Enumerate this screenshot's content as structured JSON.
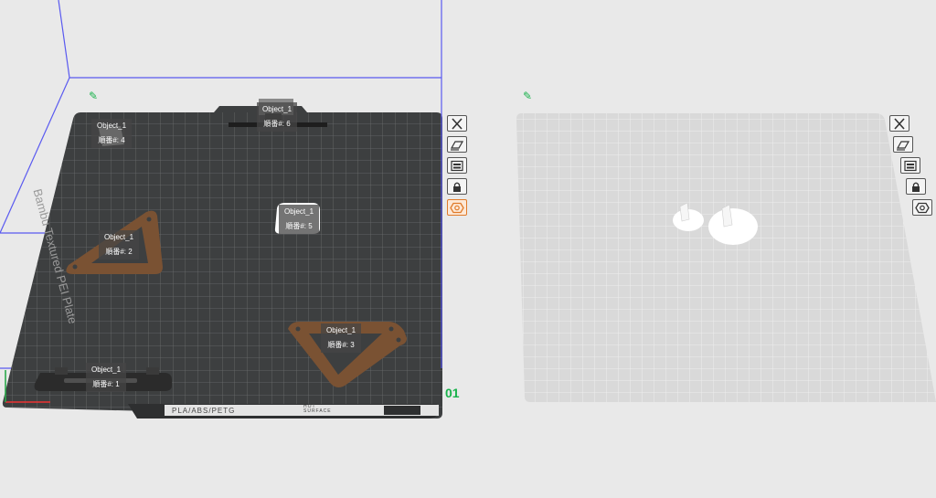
{
  "plates": [
    {
      "number_label": "01",
      "brand_text": "Bambu Textured PEI Plate",
      "material_text": "PLA/ABS/PETG",
      "surface_text": "HOT SURFACE",
      "objects": [
        {
          "name": "Object_1",
          "order": "順番#: 4"
        },
        {
          "name": "Object_1",
          "order": "順番#: 6"
        },
        {
          "name": "Object_1",
          "order": "順番#: 5"
        },
        {
          "name": "Object_1",
          "order": "順番#: 2"
        },
        {
          "name": "Object_1",
          "order": "順番#: 3"
        },
        {
          "name": "Object_1",
          "order": "順番#: 1"
        }
      ]
    },
    {
      "number_label": "",
      "objects": []
    }
  ],
  "toolbar_icons": [
    "close-icon",
    "auto-orient-icon",
    "arrange-icon",
    "lock-icon",
    "plate-settings-icon"
  ],
  "colors": {
    "dark_plate": "#3d3f40",
    "light_plate": "#d9d9d9",
    "bounding_box": "#5a5af0",
    "wood_part": "#7a5233",
    "dark_part": "#2b2b2b",
    "white_part": "#ffffff",
    "accent_green": "#19b24b",
    "accent_orange": "#e07b2a"
  }
}
